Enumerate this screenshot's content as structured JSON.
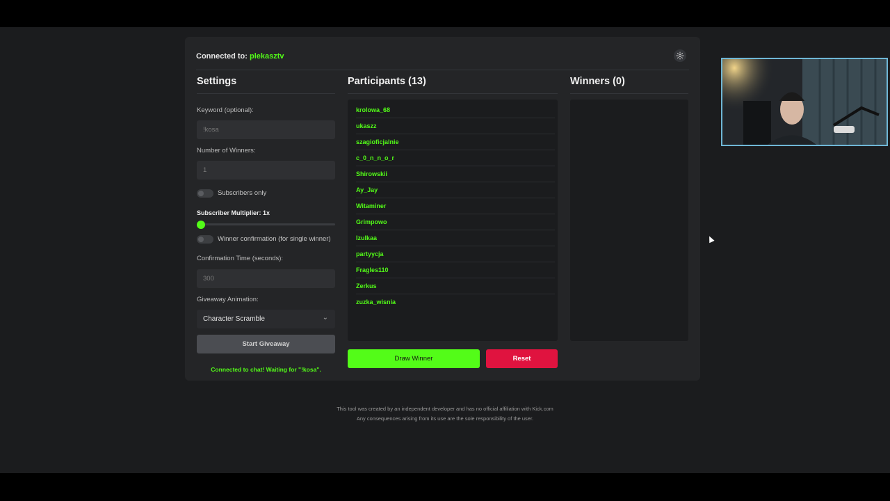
{
  "header": {
    "connected_label": "Connected to:",
    "channel": "plekasztv"
  },
  "settings": {
    "title": "Settings",
    "keyword_label": "Keyword (optional):",
    "keyword_value": "!kosa",
    "winners_label": "Number of Winners:",
    "winners_value": "1",
    "subscribers_only_label": "Subscribers only",
    "multiplier_label": "Subscriber Multiplier: 1x",
    "multiplier_value": 1,
    "confirmation_label": "Winner confirmation (for single winner)",
    "confirm_time_label": "Confirmation Time (seconds):",
    "confirm_time_value": "300",
    "animation_label": "Giveaway Animation:",
    "animation_value": "Character Scramble",
    "start_button": "Start Giveaway",
    "status": "Connected to chat! Waiting for \"!kosa\"."
  },
  "participants": {
    "title": "Participants (13)",
    "items": [
      "krolowa_68",
      "ukaszz",
      "szagioficjalnie",
      "c_0_n_n_o_r",
      "Shirowskii",
      "Ay_Jay",
      "Witaminer",
      "Grimpowo",
      "Izulkaa",
      "partyycja",
      "Fragles110",
      "Zerkus",
      "zuzka_wisnia"
    ],
    "draw_button": "Draw Winner",
    "reset_button": "Reset"
  },
  "winners": {
    "title": "Winners (0)"
  },
  "footer": {
    "line1": "This tool was created by an independent developer and has no official affiliation with Kick.com",
    "line2": "Any consequences arising from its use are the sole responsibility of the user."
  },
  "colors": {
    "accent": "#53fc18",
    "reset": "#e0133f",
    "card": "#242527",
    "background": "#1b1c1e"
  }
}
